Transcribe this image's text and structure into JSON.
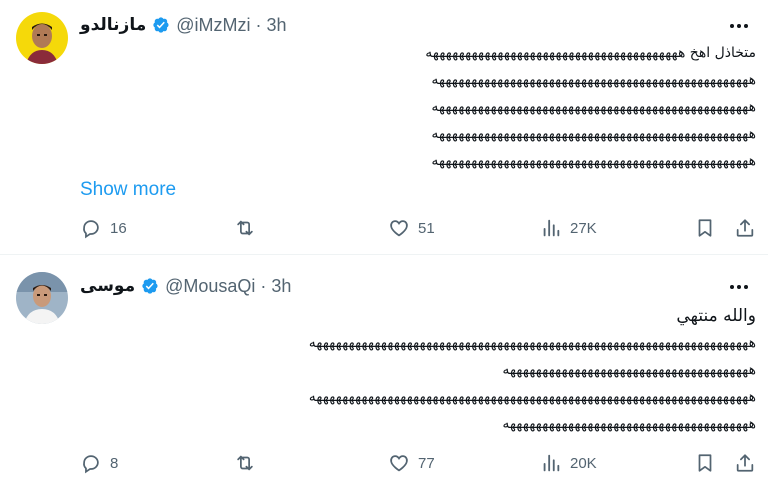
{
  "tweets": [
    {
      "name": "مازنالدو",
      "handle": "@iMzMzi",
      "separator": "·",
      "time": "3h",
      "lines": [
        "متخاذل اهخ هههههههههههههههههههههههههههههههههههههههه",
        "هههههههههههههههههههههههههههههههههههههههههههههههههه",
        "هههههههههههههههههههههههههههههههههههههههههههههههههه",
        "هههههههههههههههههههههههههههههههههههههههههههههههههه",
        "هههههههههههههههههههههههههههههههههههههههههههههههههه"
      ],
      "show_more": "Show more",
      "replies": "16",
      "reposts": "",
      "likes": "51",
      "views": "27K",
      "avatar_bg": "#f5d90a"
    },
    {
      "name": "موسى",
      "handle": "@MousaQi",
      "separator": "·",
      "time": "3h",
      "lines": [
        "والله منتهي",
        "ههههههههههههههههههههههههههههههههههههههههههههههههههههههههههههههههههههه",
        "ههههههههههههههههههههههههههههههههههههههه",
        "ههههههههههههههههههههههههههههههههههههههههههههههههههههههههههههههههههههه",
        "ههههههههههههههههههههههههههههههههههههههه"
      ],
      "replies": "8",
      "reposts": "",
      "likes": "77",
      "views": "20K",
      "avatar_bg": "#9fb4c7"
    }
  ],
  "colors": {
    "accent": "#1d9bf0",
    "text": "#0f1419",
    "secondary": "#536471",
    "verified": "#1d9bf0"
  },
  "icons": [
    "verified-icon",
    "more-icon",
    "reply-icon",
    "repost-icon",
    "like-icon",
    "views-icon",
    "bookmark-icon",
    "share-icon"
  ]
}
